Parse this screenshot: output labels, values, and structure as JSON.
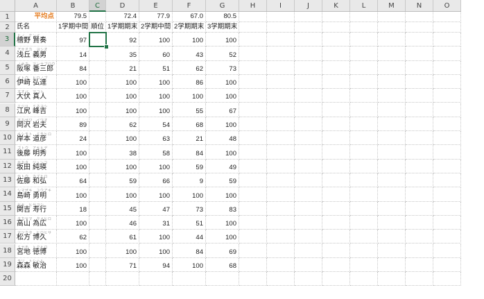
{
  "columns": [
    "A",
    "B",
    "C",
    "D",
    "E",
    "F",
    "G",
    "H",
    "I",
    "J",
    "K",
    "L",
    "M",
    "N",
    "O"
  ],
  "selected_column": "C",
  "selected_row": 3,
  "avg_row": {
    "label": "平均点",
    "values": [
      "79.5",
      "",
      "72.4",
      "77.9",
      "67.0",
      "80.5"
    ]
  },
  "headers": [
    "氏名",
    "1学期中間",
    "順位",
    "1学期期末",
    "2学期中間",
    "2学期期末",
    "3学期期末"
  ],
  "students": [
    {
      "furigana": "ヒノ　ケンイ",
      "name": "檜野 賢奏",
      "scores": [
        "97",
        "",
        "92",
        "100",
        "100",
        "100"
      ]
    },
    {
      "furigana": "アサオカ　ヨシオ",
      "name": "浅丘 義男",
      "scores": [
        "14",
        "",
        "35",
        "60",
        "43",
        "52"
      ]
    },
    {
      "furigana": "ノサカ　マンサブロウ",
      "name": "阪塚 番三郎",
      "scores": [
        "84",
        "",
        "21",
        "51",
        "62",
        "73"
      ]
    },
    {
      "furigana": "イトウ　ヒロノブ",
      "name": "伊崎 弘達",
      "scores": [
        "100",
        "",
        "100",
        "100",
        "86",
        "100"
      ]
    },
    {
      "furigana": "オオバ　マコト",
      "name": "大伏 真人",
      "scores": [
        "100",
        "",
        "100",
        "100",
        "100",
        "100"
      ]
    },
    {
      "furigana": "エジリ　ミネヨシ",
      "name": "江尻 峰吉",
      "scores": [
        "100",
        "",
        "100",
        "100",
        "55",
        "67"
      ]
    },
    {
      "furigana": "オカザワ　イワオ",
      "name": "岡沢 岩夫",
      "scores": [
        "89",
        "",
        "62",
        "54",
        "68",
        "100"
      ]
    },
    {
      "furigana": "キシモト　ミチヒロ",
      "name": "岸本 道彦",
      "scores": [
        "24",
        "",
        "100",
        "63",
        "21",
        "48"
      ]
    },
    {
      "furigana": "ゴトウ　アキヒデ",
      "name": "後藤 明秀",
      "scores": [
        "100",
        "",
        "38",
        "58",
        "84",
        "100"
      ]
    },
    {
      "furigana": "サカタ　ジュンコ",
      "name": "坂田 純瑛",
      "scores": [
        "100",
        "",
        "100",
        "100",
        "59",
        "49"
      ]
    },
    {
      "furigana": "サトウ　カズヒロ",
      "name": "佐藤 和弘",
      "scores": [
        "64",
        "",
        "59",
        "66",
        "9",
        "59"
      ]
    },
    {
      "furigana": "シマザキ　ユウアキ",
      "name": "島崎 勇明",
      "scores": [
        "100",
        "",
        "100",
        "100",
        "100",
        "100"
      ]
    },
    {
      "furigana": "セキ　ヒサヨシ",
      "name": "関吉 寿行",
      "scores": [
        "18",
        "",
        "45",
        "47",
        "73",
        "83"
      ]
    },
    {
      "furigana": "タカヤマ　タメヒロ",
      "name": "高山 為広",
      "scores": [
        "100",
        "",
        "46",
        "31",
        "51",
        "100"
      ]
    },
    {
      "furigana": "マツカタ　ヒロヒサ",
      "name": "松方 博久",
      "scores": [
        "62",
        "",
        "61",
        "100",
        "44",
        "100"
      ]
    },
    {
      "furigana": "ミヤチ　トクヒロ",
      "name": "宮地 徳博",
      "scores": [
        "100",
        "",
        "100",
        "100",
        "84",
        "69"
      ]
    },
    {
      "furigana": "モリ　トシハル",
      "name": "森森 敏治",
      "scores": [
        "100",
        "",
        "71",
        "94",
        "100",
        "68"
      ]
    }
  ]
}
